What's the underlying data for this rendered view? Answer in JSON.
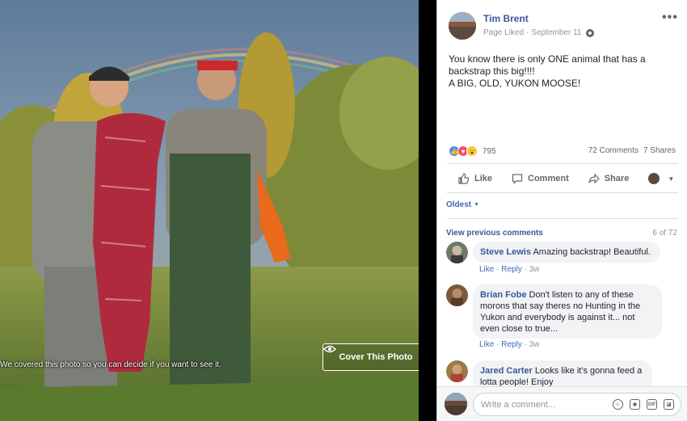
{
  "photo": {
    "cover_note": "We covered this photo so you can decide if you want to see it.",
    "cover_button_label": "Cover This Photo"
  },
  "post": {
    "author": "Tim Brent",
    "status": "Page Liked",
    "date": "September 11",
    "separator": "·",
    "text_lines": [
      "You know there is only ONE animal that has a backstrap this big!!!!",
      "A BIG, OLD, YUKON MOOSE!"
    ],
    "reaction_count": "795",
    "comments_count": "72 Comments",
    "shares_count": "7 Shares"
  },
  "actions": {
    "like": "Like",
    "comment": "Comment",
    "share": "Share"
  },
  "comments_section": {
    "sort_label": "Oldest",
    "view_previous": "View previous comments",
    "page_info": "6 of 72",
    "items": [
      {
        "name": "Steve Lewis",
        "text": "Amazing backstrap! Beautiful.",
        "like": "Like",
        "reply": "Reply",
        "time": "3w"
      },
      {
        "name": "Brian Fobe",
        "text": "Don't listen to any of these morons that say theres no Hunting in the Yukon and everybody is against it... not even close to true...",
        "like": "Like",
        "reply": "Reply",
        "time": "3w"
      },
      {
        "name": "Jared Carter",
        "text": "Looks like it's gonna feed a lotta people! Enjoy"
      }
    ]
  },
  "composer": {
    "placeholder": "Write a comment...",
    "gif_label": "GIF"
  },
  "colors": {
    "link_blue": "#385898",
    "facebook_blue": "#4267b2",
    "muted_text": "#90949c"
  }
}
